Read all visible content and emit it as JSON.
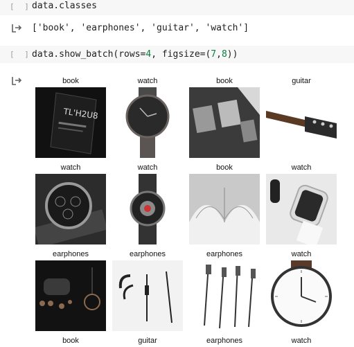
{
  "cells": [
    {
      "run_marker": "[ ]",
      "code": "data.classes"
    },
    {
      "run_marker": "[ ]",
      "code_prefix": "data.show_batch(rows=",
      "arg1": "4",
      "code_mid": ", figsize=(",
      "arg2": "7",
      "code_sep": ",",
      "arg3": "8",
      "code_suffix": "))"
    }
  ],
  "outputs": {
    "classes_text": "['book', 'earphones', 'guitar', 'watch']"
  },
  "batch": [
    {
      "label": "book",
      "image": "black book cover"
    },
    {
      "label": "watch",
      "image": "dark watch with mesh strap"
    },
    {
      "label": "book",
      "image": "open illustrated book"
    },
    {
      "label": "guitar",
      "image": "guitar neck"
    },
    {
      "label": "watch",
      "image": "chronograph watch"
    },
    {
      "label": "watch",
      "image": "skeleton watch"
    },
    {
      "label": "book",
      "image": "open book pages"
    },
    {
      "label": "watch",
      "image": "smart watch"
    },
    {
      "label": "earphones",
      "image": "earbuds with case"
    },
    {
      "label": "earphones",
      "image": "wired earphones"
    },
    {
      "label": "earphones",
      "image": "several earphones"
    },
    {
      "label": "watch",
      "image": "white dial watch"
    },
    {
      "label": "book",
      "image": ""
    },
    {
      "label": "guitar",
      "image": ""
    },
    {
      "label": "earphones",
      "image": ""
    },
    {
      "label": "watch",
      "image": ""
    }
  ]
}
